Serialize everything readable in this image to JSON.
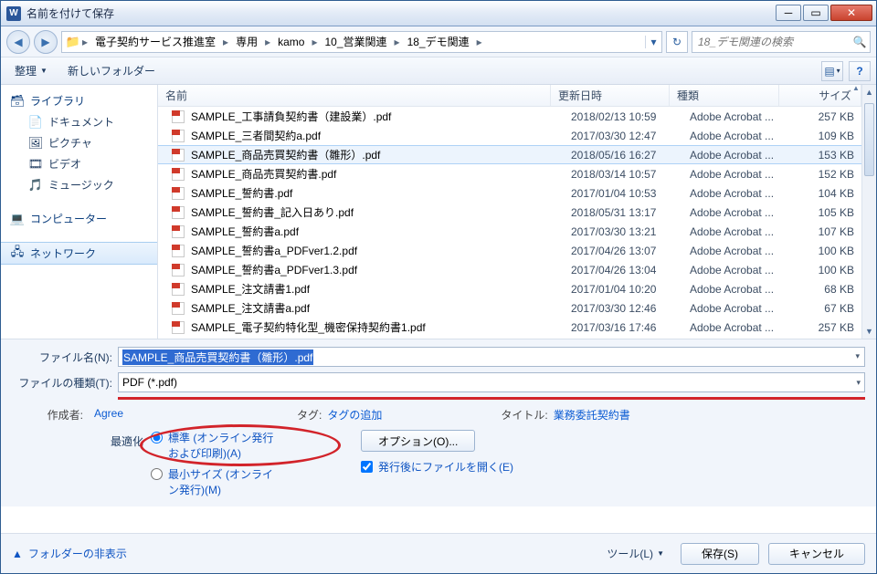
{
  "window": {
    "title": "名前を付けて保存"
  },
  "breadcrumb": {
    "items": [
      "電子契約サービス推進室",
      "専用",
      "kamo",
      "10_営業関連",
      "18_デモ関連"
    ]
  },
  "search": {
    "placeholder": "18_デモ関連の検索"
  },
  "toolbar": {
    "organize": "整理",
    "newfolder": "新しいフォルダー"
  },
  "sidebar": {
    "libraries": "ライブラリ",
    "documents": "ドキュメント",
    "pictures": "ピクチャ",
    "videos": "ビデオ",
    "music": "ミュージック",
    "computer": "コンピューター",
    "network": "ネットワーク"
  },
  "columns": {
    "name": "名前",
    "date": "更新日時",
    "type": "種類",
    "size": "サイズ"
  },
  "files": [
    {
      "name": "SAMPLE_工事請負契約書（建設業）.pdf",
      "date": "2018/02/13 10:59",
      "type": "Adobe Acrobat ...",
      "size": "257 KB",
      "sel": false
    },
    {
      "name": "SAMPLE_三者間契約a.pdf",
      "date": "2017/03/30 12:47",
      "type": "Adobe Acrobat ...",
      "size": "109 KB",
      "sel": false
    },
    {
      "name": "SAMPLE_商品売買契約書（雛形）.pdf",
      "date": "2018/05/16 16:27",
      "type": "Adobe Acrobat ...",
      "size": "153 KB",
      "sel": true
    },
    {
      "name": "SAMPLE_商品売買契約書.pdf",
      "date": "2018/03/14 10:57",
      "type": "Adobe Acrobat ...",
      "size": "152 KB",
      "sel": false
    },
    {
      "name": "SAMPLE_誓約書.pdf",
      "date": "2017/01/04 10:53",
      "type": "Adobe Acrobat ...",
      "size": "104 KB",
      "sel": false
    },
    {
      "name": "SAMPLE_誓約書_記入日あり.pdf",
      "date": "2018/05/31 13:17",
      "type": "Adobe Acrobat ...",
      "size": "105 KB",
      "sel": false
    },
    {
      "name": "SAMPLE_誓約書a.pdf",
      "date": "2017/03/30 13:21",
      "type": "Adobe Acrobat ...",
      "size": "107 KB",
      "sel": false
    },
    {
      "name": "SAMPLE_誓約書a_PDFver1.2.pdf",
      "date": "2017/04/26 13:07",
      "type": "Adobe Acrobat ...",
      "size": "100 KB",
      "sel": false
    },
    {
      "name": "SAMPLE_誓約書a_PDFver1.3.pdf",
      "date": "2017/04/26 13:04",
      "type": "Adobe Acrobat ...",
      "size": "100 KB",
      "sel": false
    },
    {
      "name": "SAMPLE_注文請書1.pdf",
      "date": "2017/01/04 10:20",
      "type": "Adobe Acrobat ...",
      "size": "68 KB",
      "sel": false
    },
    {
      "name": "SAMPLE_注文請書a.pdf",
      "date": "2017/03/30 12:46",
      "type": "Adobe Acrobat ...",
      "size": "67 KB",
      "sel": false
    },
    {
      "name": "SAMPLE_電子契約特化型_機密保持契約書1.pdf",
      "date": "2017/03/16 17:46",
      "type": "Adobe Acrobat ...",
      "size": "257 KB",
      "sel": false
    }
  ],
  "form": {
    "filename_label": "ファイル名(N):",
    "filename_value": "SAMPLE_商品売買契約書（雛形）.pdf",
    "filetype_label": "ファイルの種類(T):",
    "filetype_value": "PDF (*.pdf)",
    "author_label": "作成者:",
    "author_value": "Agree",
    "tags_label": "タグ:",
    "tags_value": "タグの追加",
    "title_label": "タイトル:",
    "title_value": "業務委託契約書",
    "optimize_label": "最適化",
    "radio1": "標準 (オンライン発行\nおよび印刷)(A)",
    "radio2": "最小サイズ (オンライ\nン発行)(M)",
    "options_btn": "オプション(O)...",
    "openafter": "発行後にファイルを開く(E)"
  },
  "footer": {
    "hide": "フォルダーの非表示",
    "tools": "ツール(L)",
    "save": "保存(S)",
    "cancel": "キャンセル"
  }
}
